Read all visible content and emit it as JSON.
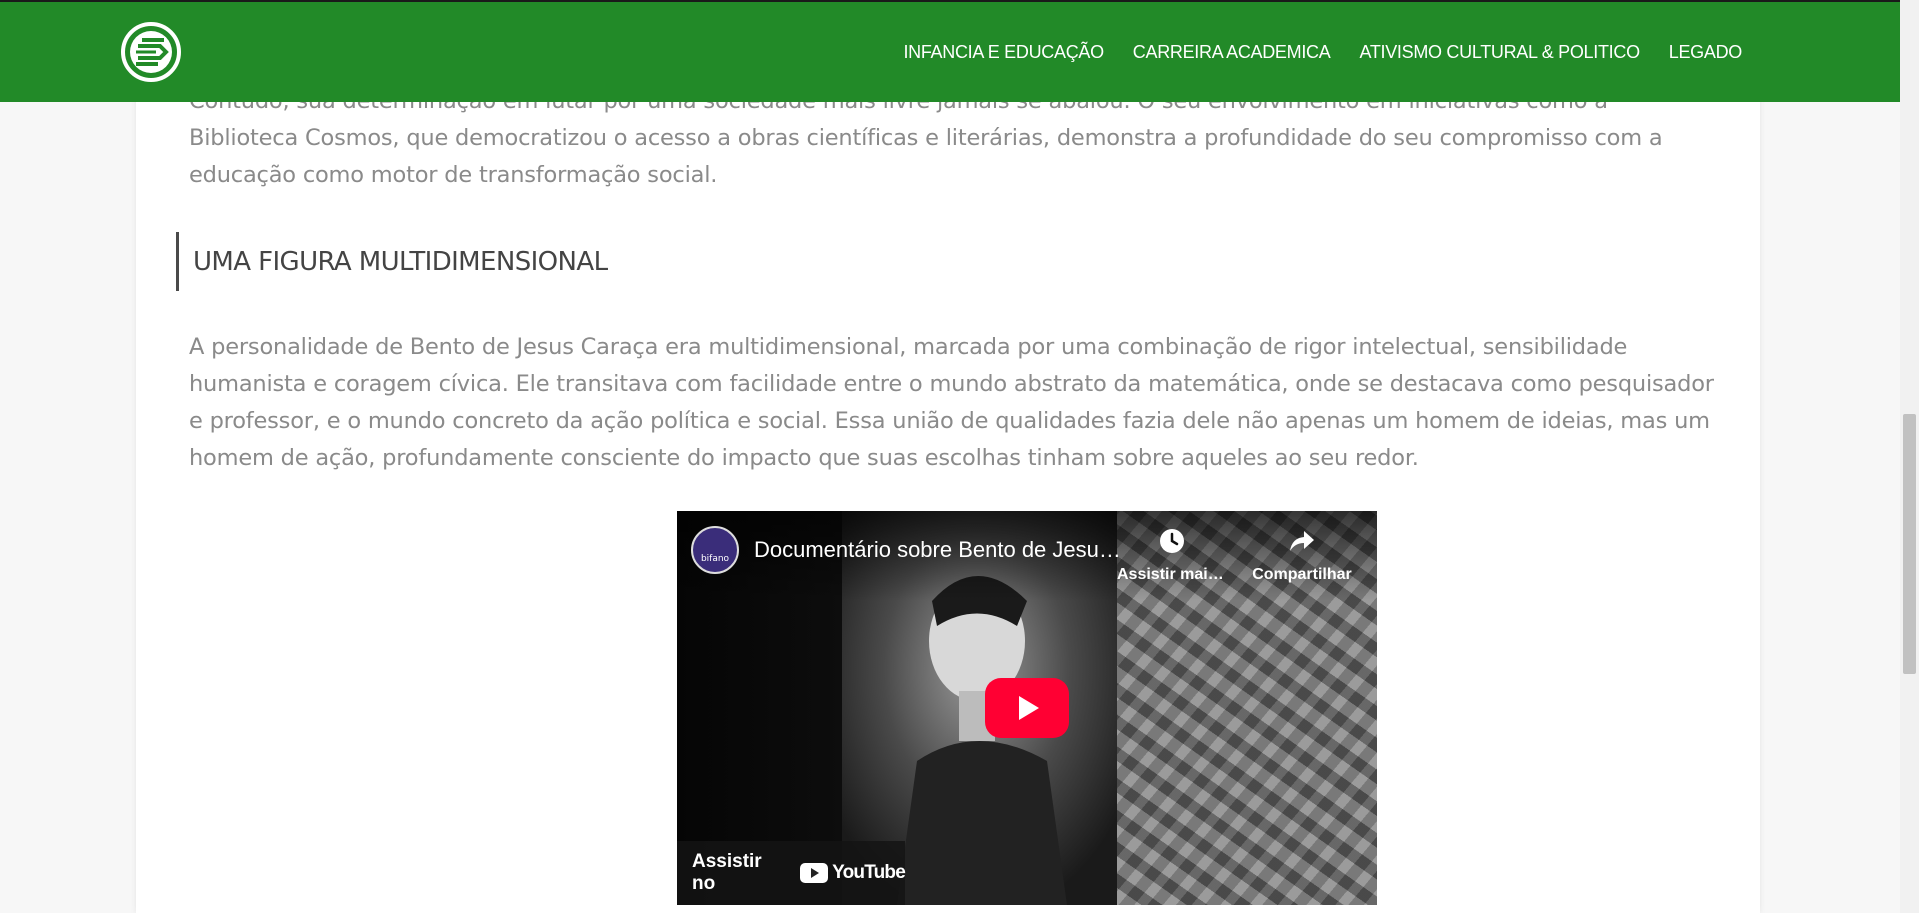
{
  "nav": {
    "items": [
      {
        "label": "INFANCIA E EDUCAÇÃO"
      },
      {
        "label": "CARREIRA ACADEMICA"
      },
      {
        "label": "ATIVISMO CULTURAL & POLITICO"
      },
      {
        "label": "LEGADO"
      }
    ],
    "logo_icon": "site-logo-icon"
  },
  "content": {
    "intro_paragraph": "Contudo, sua determinação em lutar por uma sociedade mais livre jamais se abalou. O seu envolvimento em iniciativas como a Biblioteca Cosmos, que democratizou o acesso a obras científicas e literárias, demonstra a profundidade do seu compromisso com a educação como motor de transformação social.",
    "section_heading": "UMA FIGURA MULTIDIMENSIONAL",
    "section_paragraph": "A personalidade de Bento de Jesus Caraça era multidimensional, marcada por uma combinação de rigor intelectual, sensibilidade humanista e coragem cívica. Ele transitava com facilidade entre o mundo abstrato da matemática, onde se destacava como pesquisador e professor, e o mundo concreto da ação política e social. Essa união de qualidades fazia dele não apenas um homem de ideias, mas um homem de ação, profundamente consciente do impacto que suas escolhas tinham sobre aqueles ao seu redor."
  },
  "video": {
    "title": "Documentário sobre Bento de Jesus Caraça",
    "watch_later_label": "Assistir mais tarde",
    "share_label": "Compartilhar",
    "watch_on_label": "Assistir no",
    "platform_name": "YouTube",
    "channel_avatar_text": "bifano"
  },
  "colors": {
    "header_green": "#228a28",
    "play_red": "#ff0033",
    "body_text": "#8a8a8a"
  }
}
